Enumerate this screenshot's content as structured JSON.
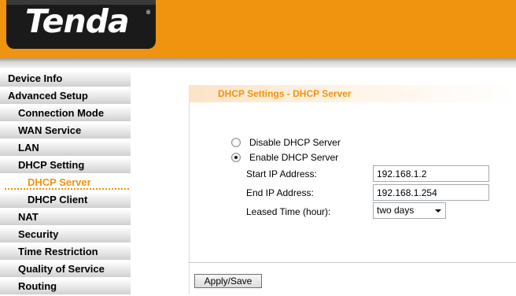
{
  "brand": {
    "name": "Tenda",
    "registered_mark": "®",
    "header_color": "#F0930E"
  },
  "sidebar": {
    "items": [
      {
        "label": "Device Info"
      },
      {
        "label": "Advanced Setup"
      },
      {
        "label": "Connection Mode"
      },
      {
        "label": "WAN Service"
      },
      {
        "label": "LAN"
      },
      {
        "label": "DHCP Setting"
      },
      {
        "label": "DHCP Server",
        "active": true
      },
      {
        "label": "DHCP Client"
      },
      {
        "label": "NAT"
      },
      {
        "label": "Security"
      },
      {
        "label": "Time Restriction"
      },
      {
        "label": "Quality of Service"
      },
      {
        "label": "Routing"
      }
    ]
  },
  "main": {
    "section_title": "DHCP Settings - DHCP Server",
    "dhcp_mode": {
      "disable_label": "Disable DHCP Server",
      "enable_label": "Enable DHCP Server",
      "selected": "enable"
    },
    "start_ip": {
      "label": "Start IP Address:",
      "value": "192.168.1.2"
    },
    "end_ip": {
      "label": "End IP Address:",
      "value": "192.168.1.254"
    },
    "lease": {
      "label": "Leased Time (hour):",
      "selected": "two days"
    },
    "apply_label": "Apply/Save"
  }
}
